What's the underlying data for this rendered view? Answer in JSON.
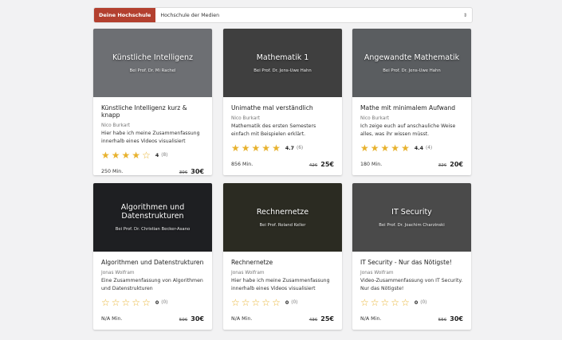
{
  "selector": {
    "badge": "Deine Hochschule",
    "value": "Hochschule der Medien",
    "arrow": "⇕"
  },
  "courses": [
    {
      "hero_title": "Künstliche Intelligenz",
      "hero_sub": "Bei Prof. Dr. Mi Rachel",
      "title": "Künstliche Intelligenz kurz & knapp",
      "author": "Nico Burkart",
      "desc": "Hier habe ich meine Zusammenfassung innerhalb eines Videos visualisiert",
      "rating_value": "4",
      "rating_count": "(8)",
      "stars_filled": 4,
      "stars_half": 0,
      "duration": "250 Min.",
      "old_price": "30€",
      "price": "30€",
      "hero_color": "#6d6f73"
    },
    {
      "hero_title": "Mathematik 1",
      "hero_sub": "Bei Prof. Dr. Jens-Uwe Hahn",
      "title": "Unimathe mal verständlich",
      "author": "Nico Burkart",
      "desc": "Mathematik des ersten Semesters einfach mit Beispielen erklärt.",
      "rating_value": "4.7",
      "rating_count": "(6)",
      "stars_filled": 4,
      "stars_half": 1,
      "duration": "856 Min.",
      "old_price": "42€",
      "price": "25€",
      "hero_color": "#3f3f3f"
    },
    {
      "hero_title": "Angewandte Mathematik",
      "hero_sub": "Bei Prof. Dr. Jens-Uwe Hahn",
      "title": "Mathe mit minimalem Aufwand",
      "author": "Nico Burkart",
      "desc": "Ich zeige euch auf anschauliche Weise alles, was ihr wissen müsst.",
      "rating_value": "4.4",
      "rating_count": "(4)",
      "stars_filled": 4,
      "stars_half": 1,
      "duration": "180 Min.",
      "old_price": "32€",
      "price": "20€",
      "hero_color": "#5a5d60"
    },
    {
      "hero_title": "Algorithmen und Datenstrukturen",
      "hero_sub": "Bei Prof. Dr. Christian Becker-Asano",
      "title": "Algorithmen und Datenstrukturen",
      "author": "Jonas Wolfram",
      "desc": "Eine Zusammenfassung von Algorithmen und Datenstrukturen",
      "rating_value": "0",
      "rating_count": "(0)",
      "stars_filled": 0,
      "stars_half": 0,
      "duration": "N/A Min.",
      "old_price": "50€",
      "price": "30€",
      "hero_color": "#1e1f22"
    },
    {
      "hero_title": "Rechnernetze",
      "hero_sub": "Bei Prof. Roland Keller",
      "title": "Rechnernetze",
      "author": "Jonas Wolfram",
      "desc": "Hier habe ich meine Zusammenfassung innerhalb eines Videos visualisiert",
      "rating_value": "0",
      "rating_count": "(0)",
      "stars_filled": 0,
      "stars_half": 0,
      "duration": "N/A Min.",
      "old_price": "43€",
      "price": "25€",
      "hero_color": "#2b2b22"
    },
    {
      "hero_title": "IT Security",
      "hero_sub": "Bei Prof. Dr. Joachim Charzinski",
      "title": "IT Security - Nur das Nötigste!",
      "author": "Jonas Wolfram",
      "desc": "Video-Zusammenfassung von IT Security. Nur das Nötigste!",
      "rating_value": "0",
      "rating_count": "(0)",
      "stars_filled": 0,
      "stars_half": 0,
      "duration": "N/A Min.",
      "old_price": "55€",
      "price": "30€",
      "hero_color": "#4a4a4a"
    }
  ],
  "colors": {
    "accent": "#b3402f",
    "star": "#e8b22e"
  }
}
